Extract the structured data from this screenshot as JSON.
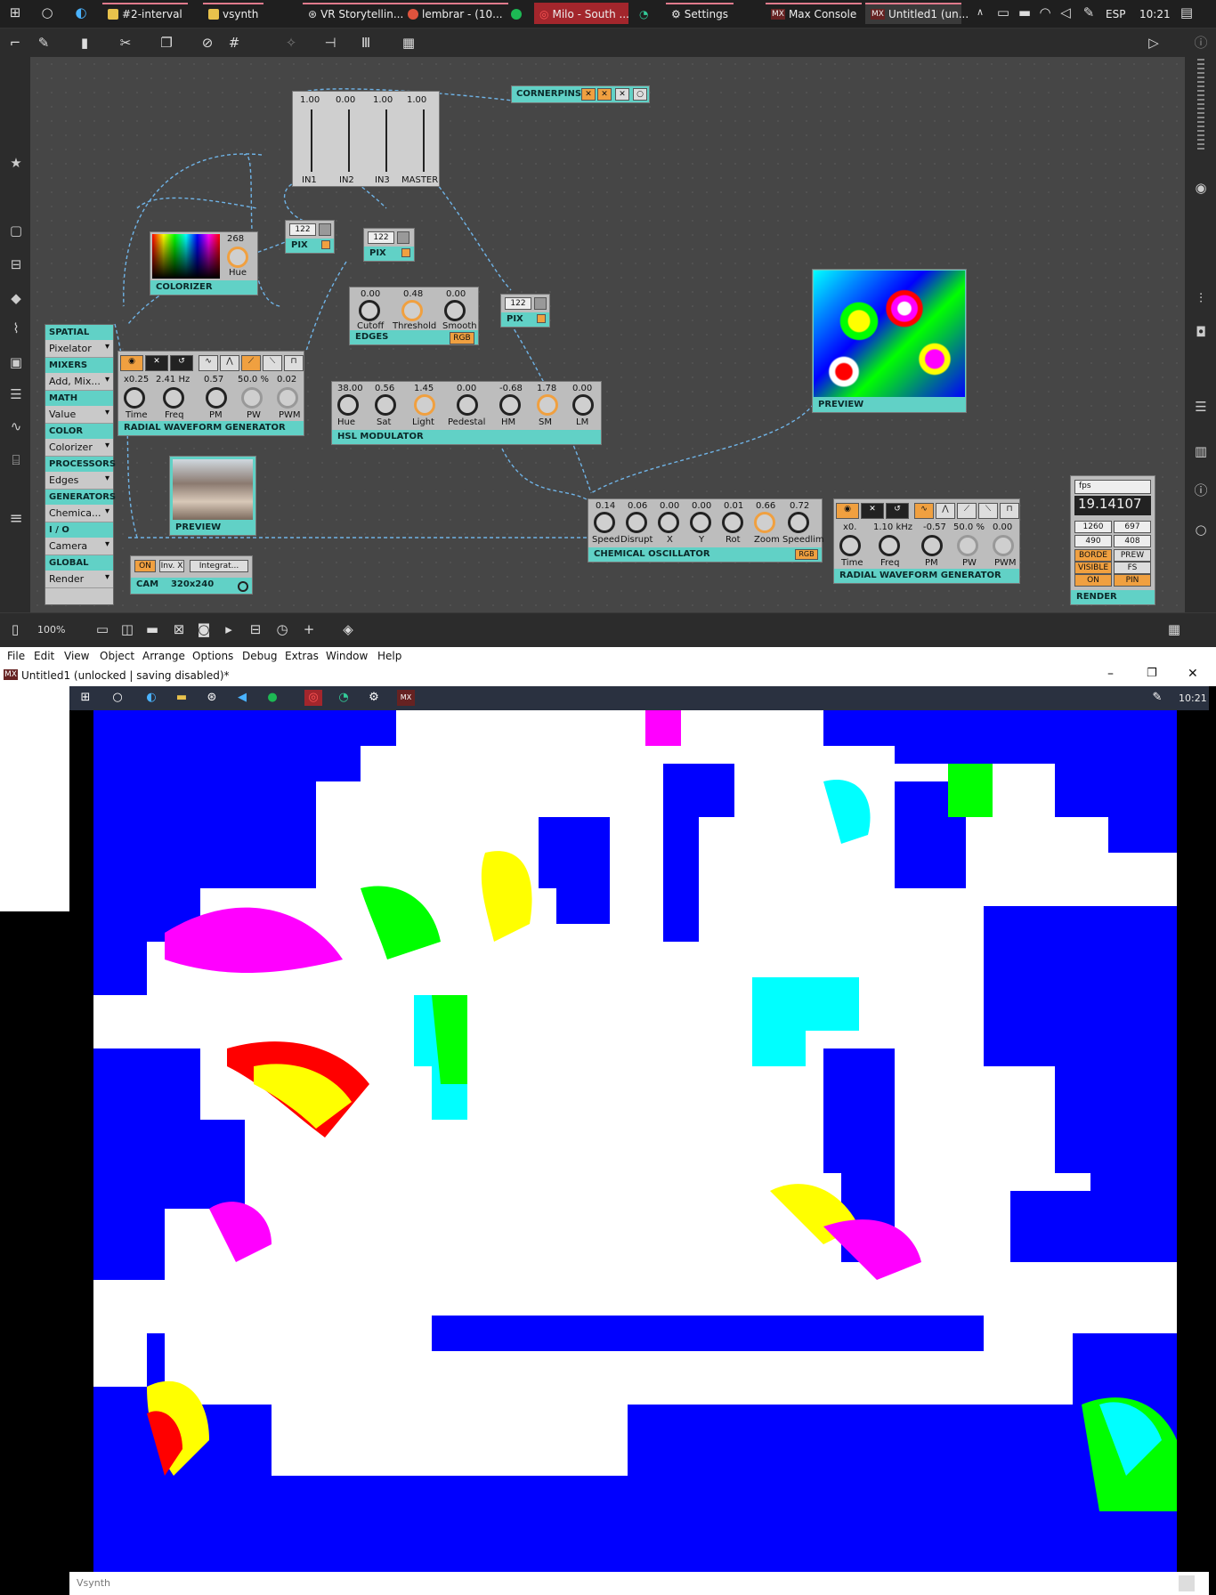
{
  "taskbar": {
    "tasks": [
      "#2-interval",
      "vsynth",
      "VR Storytellin...",
      "lembrar - (10...",
      "",
      "Milo - South ...",
      "",
      "Settings",
      "Max Console",
      "Untitled1 (un..."
    ],
    "tray": {
      "lang": "ESP",
      "time": "10:21"
    }
  },
  "menubar": {
    "items": [
      "File",
      "Edit",
      "View",
      "Object",
      "Arrange",
      "Options",
      "Debug",
      "Extras",
      "Window",
      "Help"
    ]
  },
  "window": {
    "title": "Untitled1 (unlocked | saving disabled)*"
  },
  "bottombar": {
    "zoom": "100%"
  },
  "categories": {
    "groups": [
      {
        "header": "GLOBAL",
        "items": [
          "Render"
        ]
      },
      {
        "header": "I / O",
        "items": [
          "Camera"
        ]
      },
      {
        "header": "GENERATORS",
        "items": [
          "Chemica..."
        ]
      },
      {
        "header": "PROCESSORS",
        "items": [
          "Edges"
        ]
      },
      {
        "header": "COLOR",
        "items": [
          "Colorizer"
        ]
      },
      {
        "header": "MATH",
        "items": [
          "Value"
        ]
      },
      {
        "header": "MIXERS",
        "items": [
          "Add, Mix..."
        ]
      },
      {
        "header": "SPATIAL",
        "items": [
          "Pixelator"
        ]
      }
    ]
  },
  "modules": {
    "fader": {
      "values": [
        "1.00",
        "0.00",
        "1.00",
        "1.00"
      ],
      "labels": [
        "IN1",
        "IN2",
        "IN3",
        "MASTER"
      ]
    },
    "cornerpins": {
      "title": "CORNERPINS"
    },
    "colorizer": {
      "title": "COLORIZER",
      "hue_label": "Hue",
      "hue_value": "268"
    },
    "pix1": {
      "title": "PIX",
      "value": "122"
    },
    "pix2": {
      "title": "PIX",
      "value": "122"
    },
    "pix3": {
      "title": "PIX",
      "value": "122"
    },
    "edges": {
      "title": "EDGES",
      "rgb": "RGB",
      "values": [
        "0.00",
        "0.48",
        "0.00"
      ],
      "labels": [
        "Cutoff",
        "Threshold",
        "Smooth"
      ]
    },
    "radial1": {
      "title": "RADIAL WAVEFORM GENERATOR",
      "values": [
        "x0.25",
        "2.41 Hz",
        "0.57",
        "50.0 %",
        "0.02"
      ],
      "labels": [
        "Time",
        "Freq",
        "PM",
        "PW",
        "PWM"
      ]
    },
    "hsl": {
      "title": "HSL MODULATOR",
      "values": [
        "38.00",
        "0.56",
        "1.45",
        "0.00",
        "-0.68",
        "1.78",
        "0.00"
      ],
      "labels": [
        "Hue",
        "Sat",
        "Light",
        "Pedestal",
        "HM",
        "SM",
        "LM"
      ]
    },
    "preview_top": {
      "title": "PREVIEW"
    },
    "preview_cam": {
      "title": "PREVIEW"
    },
    "cam": {
      "title": "CAM",
      "res": "320x240",
      "on": "ON",
      "inv": "Inv. X",
      "integ": "Integrat..."
    },
    "chemical": {
      "title": "CHEMICAL OSCILLATOR",
      "rgb": "RGB",
      "values": [
        "0.14",
        "0.06",
        "0.00",
        "0.00",
        "0.01",
        "0.66",
        "0.72"
      ],
      "labels": [
        "Speed",
        "Disrupt",
        "X",
        "Y",
        "Rot",
        "Zoom",
        "Speedlim"
      ]
    },
    "radial2": {
      "title": "RADIAL WAVEFORM GENERATOR",
      "values": [
        "x0.",
        "1.10 kHz",
        "-0.57",
        "50.0 %",
        "0.00"
      ],
      "labels": [
        "Time",
        "Freq",
        "PM",
        "PW",
        "PWM"
      ]
    },
    "render": {
      "title": "RENDER",
      "fps_label": "fps",
      "fps": "19.14107",
      "w": "1260",
      "h": "697",
      "w2": "490",
      "h2": "408",
      "b1": "BORDE",
      "b2": "PREW",
      "b3": "VISIBLE",
      "b4": "FS",
      "b5": "ON",
      "b6": "PIN"
    }
  },
  "vsynth_window": {
    "footer": "Vsynth",
    "tray_time": "10:21"
  }
}
